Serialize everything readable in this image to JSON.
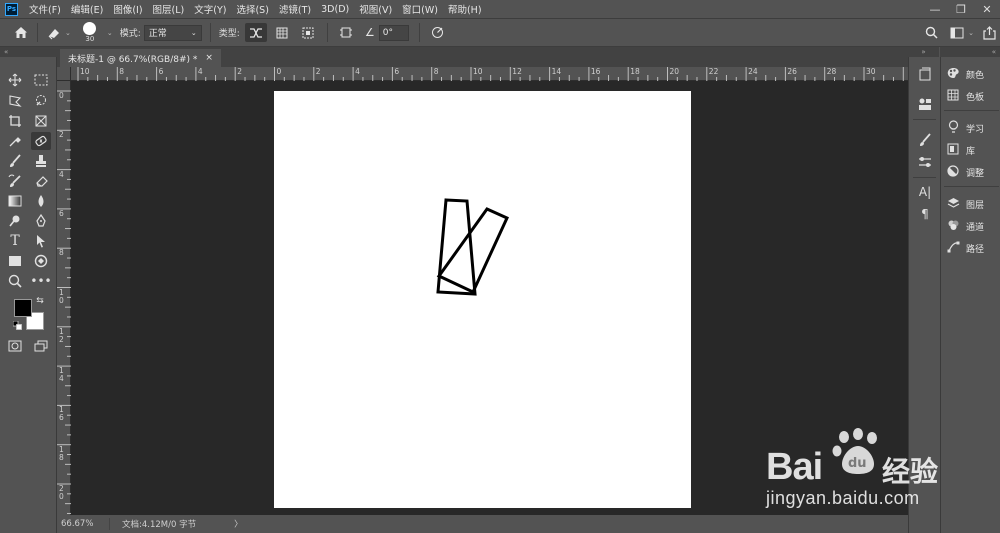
{
  "app": {
    "logo_text": "Ps",
    "menu": [
      "文件(F)",
      "编辑(E)",
      "图像(I)",
      "图层(L)",
      "文字(Y)",
      "选择(S)",
      "滤镜(T)",
      "3D(D)",
      "视图(V)",
      "窗口(W)",
      "帮助(H)"
    ],
    "window_controls": {
      "minimize": "—",
      "restore": "❐",
      "close": "✕"
    }
  },
  "options_bar": {
    "brush_size": "30",
    "mode_label": "模式:",
    "mode_value": "正常",
    "type_label": "类型:",
    "angle_value": "0°"
  },
  "document": {
    "tab_title": "未标题-1 @ 66.7%(RGB/8#) *",
    "tab_close": "×"
  },
  "ruler": {
    "horizontal": [
      "10",
      "8",
      "6",
      "4",
      "2",
      "0",
      "2",
      "4",
      "6",
      "8",
      "10",
      "12",
      "14",
      "16",
      "18",
      "20",
      "22",
      "24",
      "26",
      "28",
      "30"
    ],
    "vertical": [
      "0",
      "2",
      "4",
      "6",
      "8",
      "1\n0",
      "1\n2",
      "1\n4",
      "1\n6",
      "1\n8",
      "2\n0"
    ]
  },
  "status": {
    "zoom": "66.67%",
    "doc_info": "文档:4.12M/0 字节",
    "arrow": "〉"
  },
  "panels": {
    "right_list": [
      {
        "icon": "palette-icon",
        "label": "颜色"
      },
      {
        "icon": "grid-icon",
        "label": "色板"
      },
      {
        "icon": "bulb-icon",
        "label": "学习"
      },
      {
        "icon": "library-icon",
        "label": "库"
      },
      {
        "icon": "adjust-icon",
        "label": "调整"
      },
      {
        "icon": "layers-icon",
        "label": "图层"
      },
      {
        "icon": "channels-icon",
        "label": "通道"
      },
      {
        "icon": "paths-icon",
        "label": "路径"
      }
    ]
  },
  "watermark": {
    "brand_left": "Bai",
    "brand_right": "经验",
    "url": "jingyan.baidu.com"
  },
  "colors": {
    "foreground": "#000000",
    "background": "#ffffff",
    "pasteboard": "#282828",
    "chrome": "#535353"
  }
}
